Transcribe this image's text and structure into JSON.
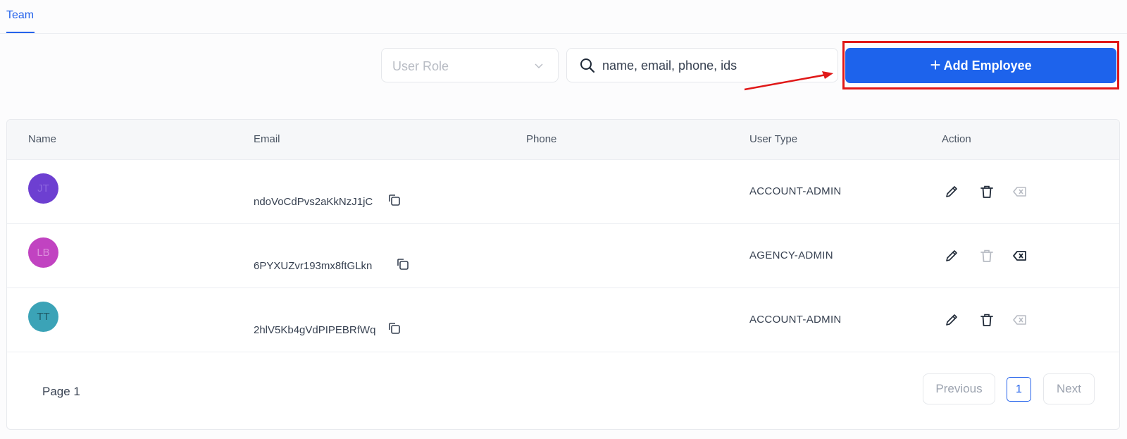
{
  "tabs": [
    {
      "label": "Team",
      "active": true
    }
  ],
  "filters": {
    "role_placeholder": "User Role",
    "search_placeholder": "name, email, phone, ids",
    "search_value": ""
  },
  "toolbar": {
    "add_label": "Add Employee",
    "add_plus": "+"
  },
  "table": {
    "columns": [
      "Name",
      "Email",
      "Phone",
      "User Type",
      "Action"
    ],
    "rows": [
      {
        "initials": "JT",
        "avatar_color": "#6d3fd1",
        "name": "",
        "email": "ndoVoCdPvs2aKkNzJ1jC",
        "phone": "",
        "user_type": "ACCOUNT-ADMIN",
        "delete_enabled": true,
        "remove_enabled": false
      },
      {
        "initials": "LB",
        "avatar_color": "#c143c1",
        "name": "",
        "email": "6PYXUZvr193mx8ftGLkn",
        "phone": "",
        "user_type": "AGENCY-ADMIN",
        "delete_enabled": false,
        "remove_enabled": true
      },
      {
        "initials": "TT",
        "avatar_color": "#3ba3b7",
        "name": "",
        "email": "2hlV5Kb4gVdPIPEBRfWq",
        "phone": "",
        "user_type": "ACCOUNT-ADMIN",
        "delete_enabled": true,
        "remove_enabled": false
      }
    ]
  },
  "pagination": {
    "page_label": "Page 1",
    "previous": "Previous",
    "current": "1",
    "next": "Next"
  },
  "colors": {
    "accent": "#1d63ec",
    "highlight": "#e01818"
  },
  "icons": {
    "search": "search-icon",
    "select": "chevron-down-icon",
    "copy": "copy-icon",
    "edit": "pencil-icon",
    "delete": "trash-icon",
    "remove": "backspace-x-icon"
  }
}
